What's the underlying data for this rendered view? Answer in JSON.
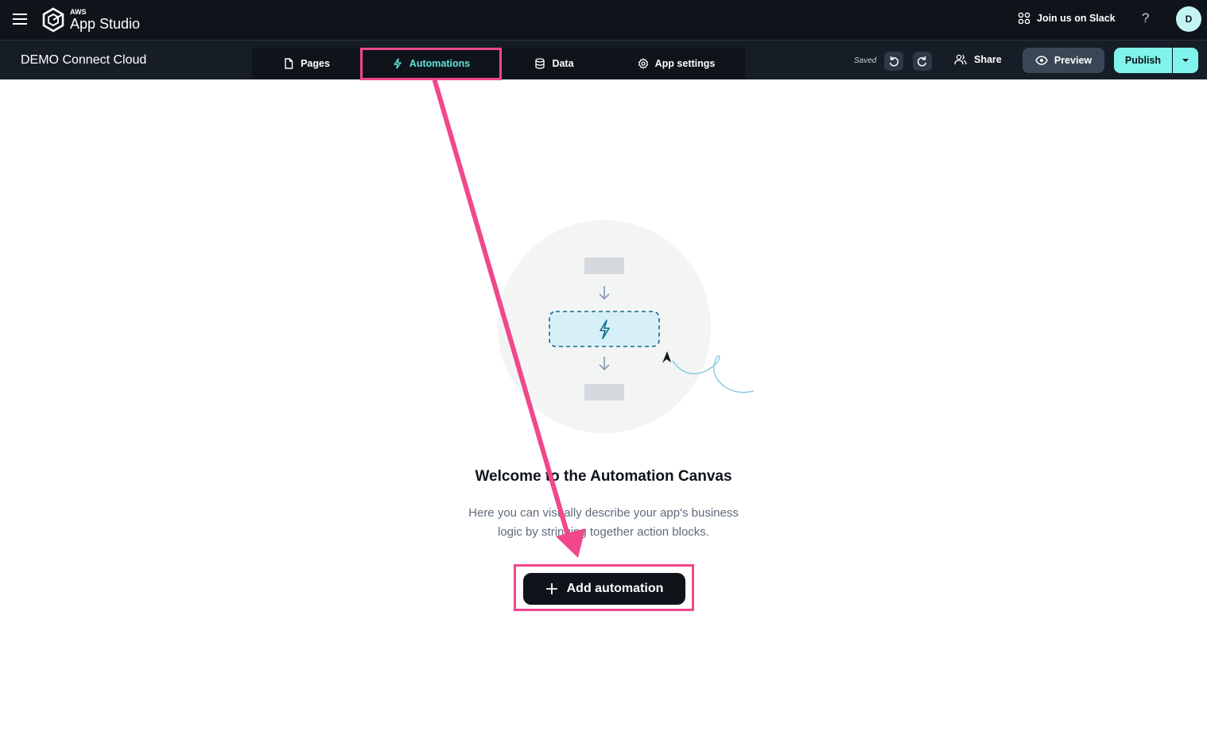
{
  "topbar": {
    "logo_small": "AWS",
    "logo_main": "App Studio",
    "slack_label": "Join us on Slack",
    "help_label": "?",
    "avatar_initial": "D"
  },
  "subbar": {
    "app_name": "DEMO Connect Cloud",
    "tabs": [
      {
        "label": "Pages",
        "icon": "file-icon"
      },
      {
        "label": "Automations",
        "icon": "bolt-icon",
        "active": true
      },
      {
        "label": "Data",
        "icon": "database-icon"
      },
      {
        "label": "App settings",
        "icon": "gear-icon"
      }
    ],
    "saved_label": "Saved",
    "share_label": "Share",
    "preview_label": "Preview",
    "publish_label": "Publish"
  },
  "canvas": {
    "welcome_title": "Welcome to the Automation Canvas",
    "description_line1": "Here you can visually describe your app's business",
    "description_line2": "logic by stringing together action blocks.",
    "add_button_label": "Add automation"
  },
  "colors": {
    "accent": "#5fe3dc",
    "publish": "#7ff3ec",
    "highlight": "#f0488a",
    "topbar": "#0f141a"
  }
}
